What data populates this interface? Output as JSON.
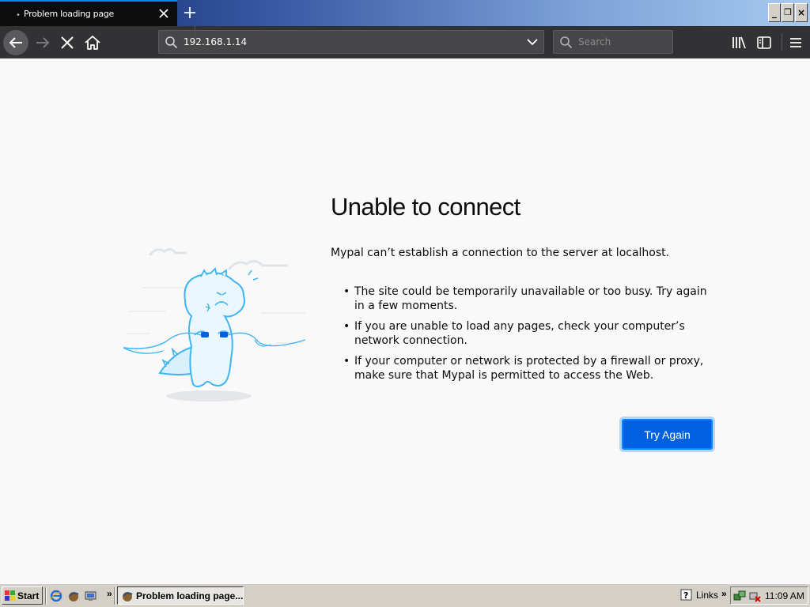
{
  "browser": {
    "tab_title": "Problem loading page",
    "tab_close_label": "×",
    "url": "192.168.1.14",
    "search_placeholder": "Search"
  },
  "window_controls": {
    "minimize": "_",
    "restore": "❐",
    "close": "×"
  },
  "error_page": {
    "title": "Unable to connect",
    "description": "Mypal can’t establish a connection to the server at localhost.",
    "bullets": [
      "The site could be temporarily unavailable or too busy. Try again in a few moments.",
      "If you are unable to load any pages, check your computer’s network connection.",
      "If your computer or network is protected by a firewall or proxy, make sure that Mypal is permitted to access the Web."
    ],
    "try_again_label": "Try Again"
  },
  "taskbar": {
    "start_label": "Start",
    "chevron": "»",
    "task_label": "Problem loading page...",
    "links_label": "Links",
    "links_chevron": "»",
    "clock": "11:09 AM"
  },
  "colors": {
    "accent": "#0a84ff",
    "button": "#0060df",
    "toolbar": "#323234",
    "tab": "#0c0c0d",
    "illustration": "#3eb5f1"
  }
}
